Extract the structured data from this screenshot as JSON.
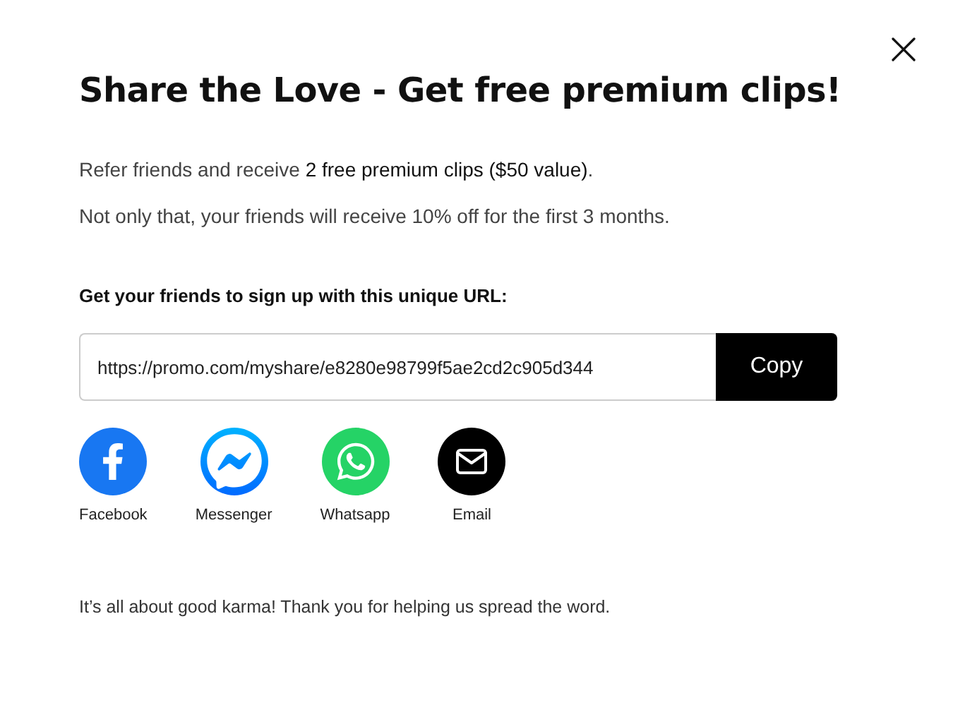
{
  "title": "Share the Love - Get free premium clips!",
  "paragraphs": [
    "Refer friends and receive **2 free premium clips ($50 value)**.",
    "Not only that, your friends will receive 10% off for the first 3 months."
  ],
  "url_label": "Get your friends to sign up with this unique URL:",
  "url_field": {
    "value": "https://promo.com/myshare/e8280e98799f5ae2cd2c905d344"
  },
  "copy_button": "Copy",
  "share": [
    {
      "kind": "facebook",
      "label": "Facebook"
    },
    {
      "kind": "messenger",
      "label": "Messenger"
    },
    {
      "kind": "whatsapp",
      "label": "Whatsapp"
    },
    {
      "kind": "email",
      "label": "Email"
    }
  ],
  "footer": "It’s all about good karma! Thank you for helping us spread the word."
}
